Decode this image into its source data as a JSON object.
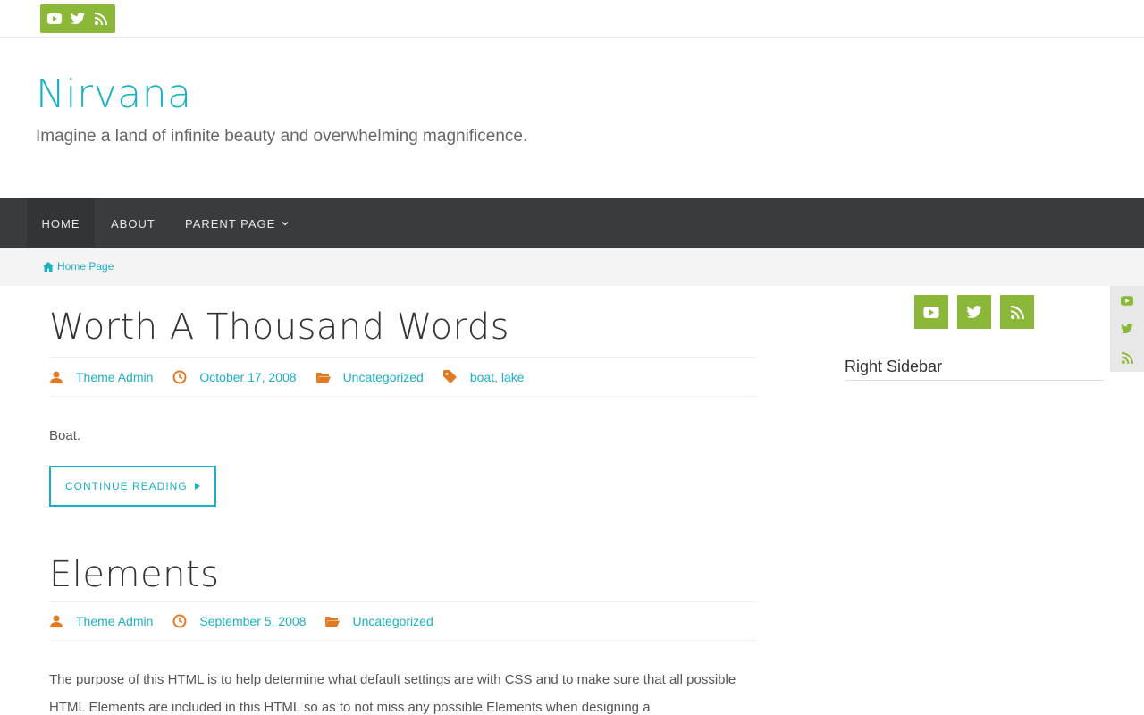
{
  "site": {
    "title": "Nirvana",
    "tagline": "Imagine a land of infinite beauty and overwhelming magnificence."
  },
  "social": {
    "icons": [
      "youtube-icon",
      "twitter-icon",
      "rss-icon"
    ],
    "accent": "#8cb83a"
  },
  "nav": {
    "items": [
      {
        "label": "HOME"
      },
      {
        "label": "ABOUT"
      },
      {
        "label": "PARENT PAGE"
      }
    ]
  },
  "breadcrumb": {
    "home": "Home Page"
  },
  "posts": [
    {
      "title": "Worth A Thousand Words",
      "author": "Theme Admin",
      "date": "October 17, 2008",
      "category": "Uncategorized",
      "tags": [
        "boat",
        "lake"
      ],
      "tag_sep": ",",
      "excerpt": "Boat.",
      "read_more": "CONTINUE READING"
    },
    {
      "title": "Elements",
      "author": "Theme Admin",
      "date": "September 5, 2008",
      "category": "Uncategorized",
      "excerpt": "The purpose of this HTML is to help determine what default settings are with CSS and to make sure that all possible HTML Elements are included in this HTML so as to not miss any possible Elements when designing a"
    }
  ],
  "sidebar": {
    "title": "Right Sidebar"
  },
  "colors": {
    "accent": "#1bb1c5",
    "nav_bg": "#3a3b3d",
    "meta_icon": "#e07b24"
  }
}
